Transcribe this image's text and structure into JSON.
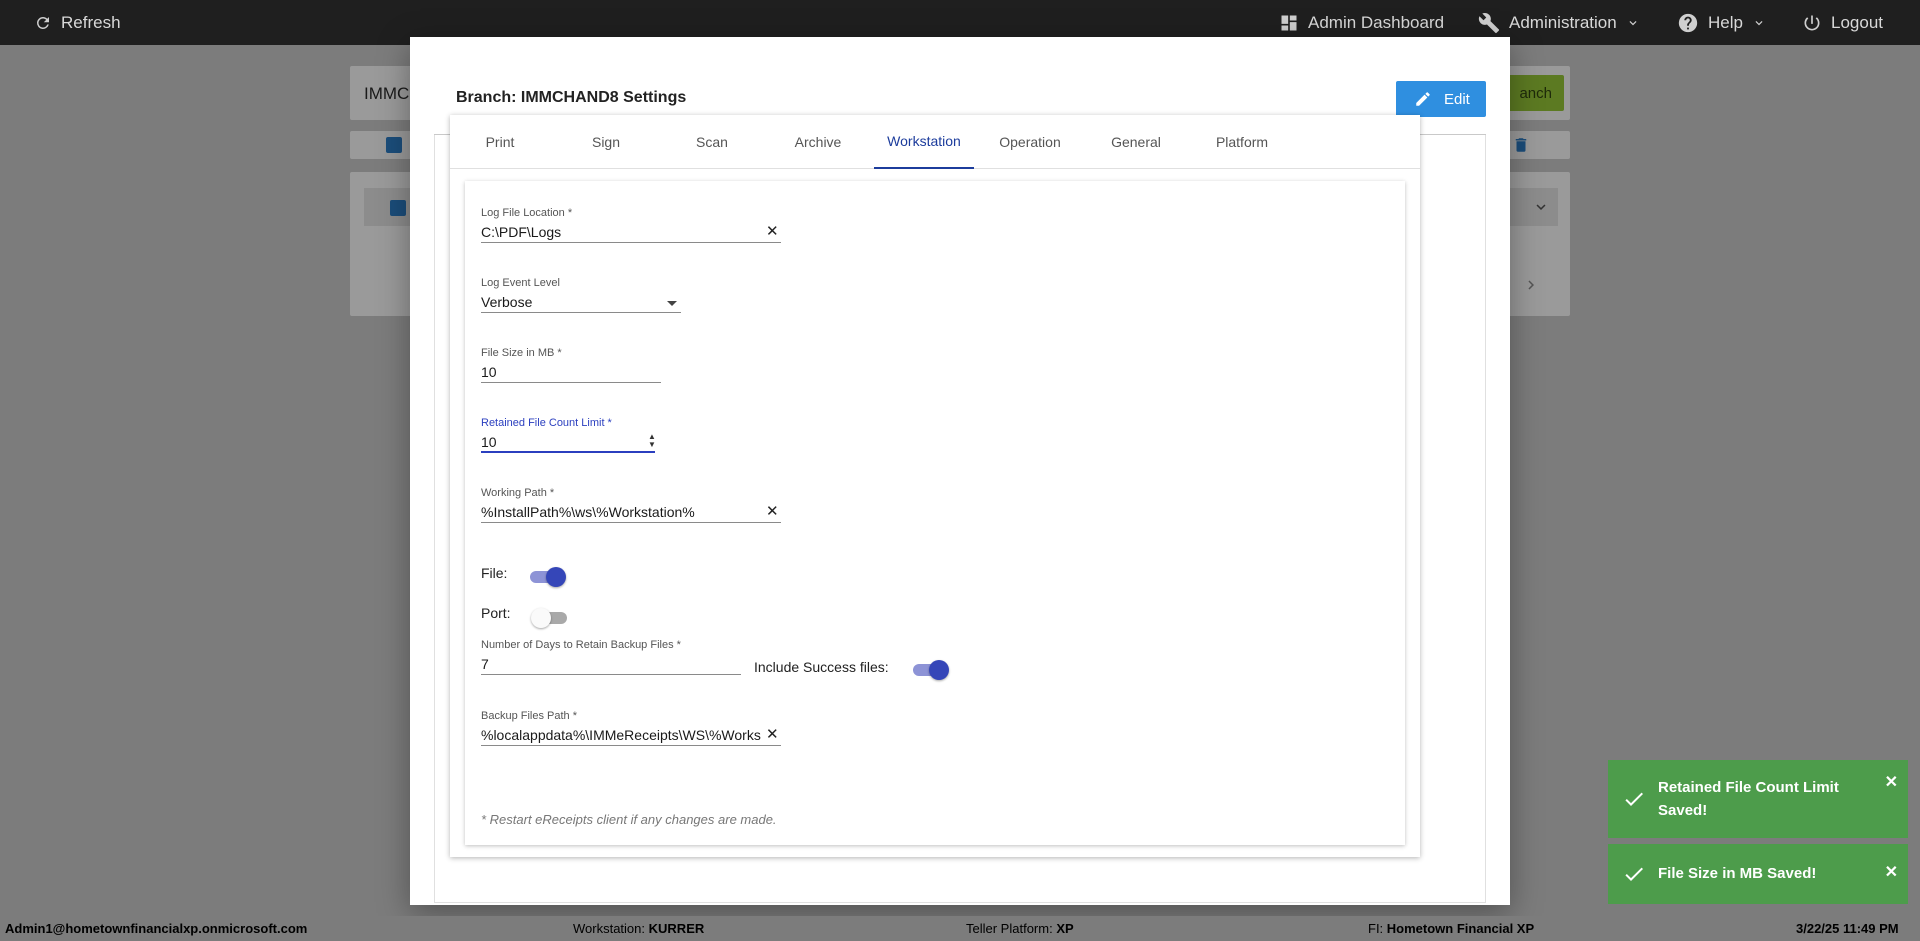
{
  "topbar": {
    "refresh_label": "Refresh",
    "admin_dashboard_label": "Admin Dashboard",
    "administration_label": "Administration",
    "help_label": "Help",
    "logout_label": "Logout"
  },
  "background": {
    "search_value": "IMMCH",
    "add_branch_label": "anch"
  },
  "modal": {
    "title": "Branch: IMMCHAND8 Settings",
    "edit_label": "Edit",
    "tabs": [
      {
        "label": "Print"
      },
      {
        "label": "Sign"
      },
      {
        "label": "Scan"
      },
      {
        "label": "Archive"
      },
      {
        "label": "Workstation",
        "active": true
      },
      {
        "label": "Operation"
      },
      {
        "label": "General"
      },
      {
        "label": "Platform"
      }
    ],
    "fields": {
      "log_file_location": {
        "label": "Log File Location *",
        "value": "C:\\PDF\\Logs"
      },
      "log_event_level": {
        "label": "Log Event Level",
        "value": "Verbose"
      },
      "file_size_mb": {
        "label": "File Size in MB *",
        "value": "10"
      },
      "retained_file_count": {
        "label": "Retained File Count Limit *",
        "value": "10"
      },
      "working_path": {
        "label": "Working Path *",
        "value": "%InstallPath%\\ws\\%Workstation%"
      },
      "file_toggle": {
        "label": "File:",
        "on": true
      },
      "port_toggle": {
        "label": "Port:",
        "on": false
      },
      "backup_days": {
        "label": "Number of Days to Retain Backup Files *",
        "value": "7"
      },
      "include_success": {
        "label": "Include Success files:",
        "on": true
      },
      "backup_path": {
        "label": "Backup Files Path *",
        "value": "%localappdata%\\IMMeReceipts\\WS\\%Works"
      }
    },
    "note": "* Restart eReceipts client if any changes are made."
  },
  "toasts": [
    {
      "line1": "Retained File Count Limit",
      "line2": "Saved!"
    },
    {
      "line1": "File Size in MB Saved!"
    }
  ],
  "statusbar": {
    "user": "Admin1@hometownfinancialxp.onmicrosoft.com",
    "workstation_label": "Workstation:",
    "workstation_value": "KURRER",
    "teller_label": "Teller Platform:",
    "teller_value": "XP",
    "fi_label": "FI:",
    "fi_value": "Hometown Financial XP",
    "datetime": "3/22/25 11:49 PM"
  },
  "colors": {
    "accent": "#1c3c9c",
    "edit_button": "#2f8fe0",
    "toast_success": "#4d9c4b",
    "topbar": "#1f1f1f"
  }
}
